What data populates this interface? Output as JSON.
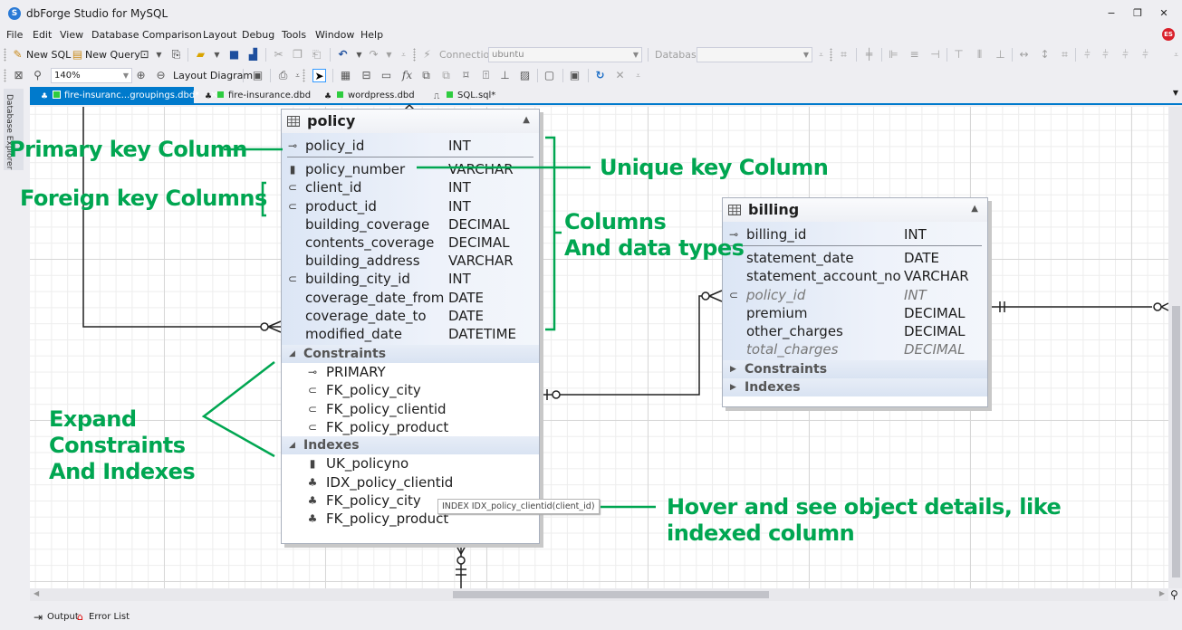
{
  "window": {
    "title": "dbForge Studio for MySQL",
    "logo": "S",
    "controls": {
      "minimize": "−",
      "restore": "❐",
      "close": "✕"
    },
    "user_initials": "ES"
  },
  "menu": [
    "File",
    "Edit",
    "View",
    "Database",
    "Comparison",
    "Layout",
    "Debug",
    "Tools",
    "Window",
    "Help"
  ],
  "toolbar1": {
    "new_sql": "New SQL",
    "new_query": "New Query",
    "connection_label": "Connection",
    "connection_value": "ubuntu",
    "database_label": "Database",
    "database_value": ""
  },
  "toolbar2": {
    "zoom_value": "140%",
    "layout_diagram": "Layout Diagram"
  },
  "tabs": [
    {
      "label": "fire-insuranc...groupings.dbd*",
      "active": true,
      "closable": true
    },
    {
      "label": "fire-insurance.dbd",
      "active": false
    },
    {
      "label": "wordpress.dbd",
      "active": false
    },
    {
      "label": "SQL.sql*",
      "active": false
    }
  ],
  "side_panel": {
    "label": "Database Explorer"
  },
  "policy": {
    "title": "policy",
    "pk": {
      "name": "policy_id",
      "type": "INT",
      "icon": "primary-key"
    },
    "columns": [
      {
        "name": "policy_number",
        "type": "VARCHAR",
        "icon": "unique-key"
      },
      {
        "name": "client_id",
        "type": "INT",
        "icon": "foreign-key"
      },
      {
        "name": "product_id",
        "type": "INT",
        "icon": "foreign-key"
      },
      {
        "name": "building_coverage",
        "type": "DECIMAL",
        "icon": ""
      },
      {
        "name": "contents_coverage",
        "type": "DECIMAL",
        "icon": ""
      },
      {
        "name": "building_address",
        "type": "VARCHAR",
        "icon": ""
      },
      {
        "name": "building_city_id",
        "type": "INT",
        "icon": "foreign-key"
      },
      {
        "name": "coverage_date_from",
        "type": "DATE",
        "icon": ""
      },
      {
        "name": "coverage_date_to",
        "type": "DATE",
        "icon": ""
      },
      {
        "name": "modified_date",
        "type": "DATETIME",
        "icon": ""
      }
    ],
    "constraints_label": "Constraints",
    "constraints": [
      {
        "name": "PRIMARY",
        "icon": "primary-key"
      },
      {
        "name": "FK_policy_city",
        "icon": "foreign-key"
      },
      {
        "name": "FK_policy_clientid",
        "icon": "foreign-key"
      },
      {
        "name": "FK_policy_product",
        "icon": "foreign-key"
      }
    ],
    "indexes_label": "Indexes",
    "indexes": [
      {
        "name": "UK_policyno",
        "icon": "unique-key"
      },
      {
        "name": "IDX_policy_clientid",
        "icon": "index"
      },
      {
        "name": "FK_policy_city",
        "icon": "index"
      },
      {
        "name": "FK_policy_product",
        "icon": "index"
      }
    ]
  },
  "billing": {
    "title": "billing",
    "pk": {
      "name": "billing_id",
      "type": "INT"
    },
    "columns": [
      {
        "name": "statement_date",
        "type": "DATE",
        "icon": "",
        "italic": false
      },
      {
        "name": "statement_account_no",
        "type": "VARCHAR",
        "icon": "",
        "italic": false
      },
      {
        "name": "policy_id",
        "type": "INT",
        "icon": "foreign-key",
        "italic": true
      },
      {
        "name": "premium",
        "type": "DECIMAL",
        "icon": "",
        "italic": false
      },
      {
        "name": "other_charges",
        "type": "DECIMAL",
        "icon": "",
        "italic": false
      },
      {
        "name": "total_charges",
        "type": "DECIMAL",
        "icon": "",
        "italic": true
      }
    ],
    "constraints_label": "Constraints",
    "indexes_label": "Indexes"
  },
  "tooltip": "INDEX IDX_policy_clientid(client_id)",
  "annotations": {
    "primary_key": "Primary key Column",
    "foreign_key": "Foreign key Columns",
    "unique_key": "Unique key Column",
    "columns_line1": "Columns",
    "columns_line2": "And data types",
    "expand_line1": "Expand",
    "expand_line2": "Constraints",
    "expand_line3": "And Indexes",
    "hover_line1": "Hover and see object details, like",
    "hover_line2": "indexed column"
  },
  "bottom_tabs": [
    "Output",
    "Error List"
  ],
  "colors": {
    "accent": "#007acc",
    "annotation": "#00a651",
    "tab_green": "#2ecc40"
  }
}
